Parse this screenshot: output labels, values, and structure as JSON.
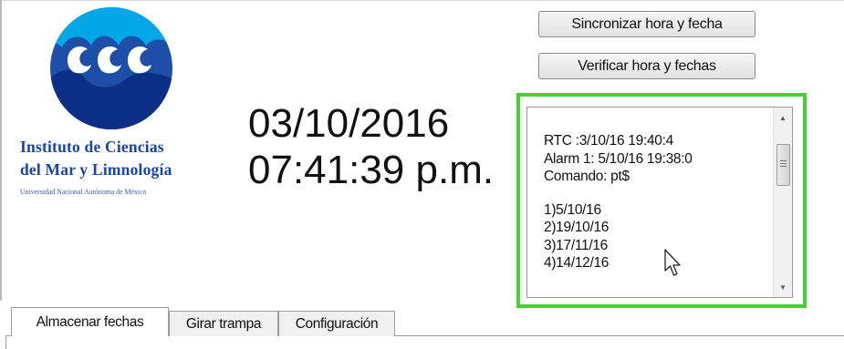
{
  "logo": {
    "icon": "icml-wave-logo",
    "institute_line1": "Instituto de Ciencias",
    "institute_line2": "del Mar y Limnología",
    "university": "Universidad Nacional Autónoma de México"
  },
  "clock": {
    "date": "03/10/2016",
    "time": "07:41:39 p.m."
  },
  "buttons": {
    "sync_label": "Sincronizar hora y fecha",
    "verify_label": "Verificar hora y fechas"
  },
  "log": {
    "lines": [
      "RTC  :3/10/16 19:40:4",
      "Alarm 1: 5/10/16 19:38:0",
      "Comando: pt$"
    ],
    "dates": [
      "1)5/10/16",
      "2)19/10/16",
      "3)17/11/16",
      "4)14/12/16"
    ],
    "highlight_color": "#45d134"
  },
  "tabs": [
    {
      "label": "Almacenar fechas",
      "active": true
    },
    {
      "label": "Girar trampa",
      "active": false
    },
    {
      "label": "Configuración",
      "active": false
    }
  ]
}
